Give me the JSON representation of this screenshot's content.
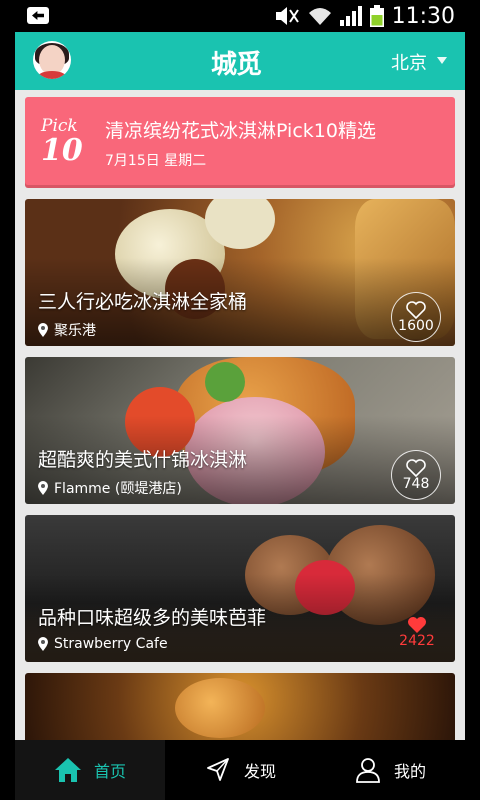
{
  "status": {
    "time": "11:30"
  },
  "header": {
    "logo": "城觅",
    "city": "北京"
  },
  "pick": {
    "word": "Pick",
    "number": "10",
    "title": "清凉缤纷花式冰淇淋Pick10精选",
    "date": "7月15日 星期二"
  },
  "cards": [
    {
      "title": "三人行必吃冰淇淋全家桶",
      "location": "聚乐港",
      "likes": "1600"
    },
    {
      "title": "超酷爽的美式什锦冰淇淋",
      "location": "Flamme (颐堤港店)",
      "likes": "748"
    },
    {
      "title": "品种口味超级多的美味芭菲",
      "location": "Strawberry Cafe",
      "likes": "2422"
    }
  ],
  "tabs": [
    {
      "label": "首页"
    },
    {
      "label": "发现"
    },
    {
      "label": "我的"
    }
  ],
  "colors": {
    "accent": "#1ac3b0",
    "pick": "#f9677a",
    "liked": "#ff3b3b"
  }
}
